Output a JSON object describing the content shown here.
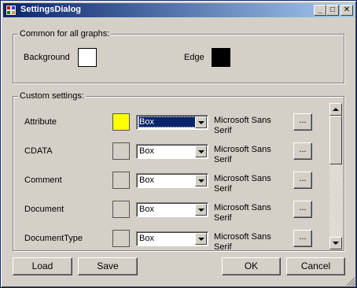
{
  "window": {
    "title": "SettingsDialog"
  },
  "titlebar_buttons": {
    "minimize": "_",
    "maximize": "□",
    "close": "✕"
  },
  "common": {
    "legend": "Common for all graphs:",
    "background_label": "Background",
    "background_color": "#ffffff",
    "edge_label": "Edge",
    "edge_color": "#000000"
  },
  "custom": {
    "legend": "Custom settings:",
    "rows": [
      {
        "name": "Attribute",
        "color": "#ffff00",
        "shape": "Box",
        "font_line1": "Microsoft Sans",
        "font_line2": "Serif",
        "button": "...",
        "selected": true
      },
      {
        "name": "CDATA",
        "color": "#d4d0c8",
        "shape": "Box",
        "font_line1": "Microsoft Sans",
        "font_line2": "Serif",
        "button": "...",
        "selected": false
      },
      {
        "name": "Comment",
        "color": "#d4d0c8",
        "shape": "Box",
        "font_line1": "Microsoft Sans",
        "font_line2": "Serif",
        "button": "...",
        "selected": false
      },
      {
        "name": "Document",
        "color": "#d4d0c8",
        "shape": "Box",
        "font_line1": "Microsoft Sans",
        "font_line2": "Serif",
        "button": "...",
        "selected": false
      },
      {
        "name": "DocumentType",
        "color": "#d4d0c8",
        "shape": "Box",
        "font_line1": "Microsoft Sans",
        "font_line2": "Serif",
        "button": "...",
        "selected": false
      }
    ]
  },
  "buttons": {
    "load": "Load",
    "save": "Save",
    "ok": "OK",
    "cancel": "Cancel"
  },
  "colors": {
    "titlebar_start": "#0a246a",
    "titlebar_end": "#a6caf0",
    "face": "#d4d0c8"
  }
}
